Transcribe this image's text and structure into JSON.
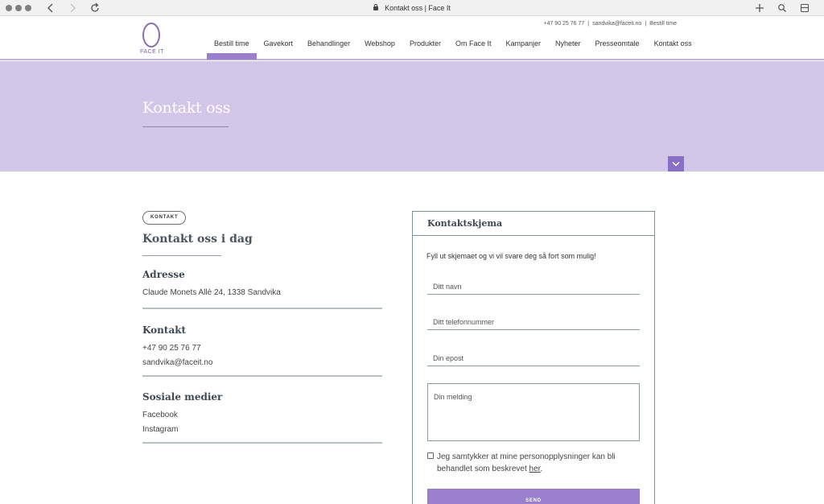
{
  "browser": {
    "tab_title": "Kontakt oss | Face It",
    "back_icon": "chevron-left-icon",
    "forward_icon": "chevron-right-icon",
    "reload_icon": "reload-icon",
    "new_tab_icon": "plus-icon",
    "search_icon": "magnifier-icon",
    "sidebar_icon": "tabs-icon"
  },
  "header": {
    "logo_text": "FACE IT",
    "top_phone": "+47 90 25 76 77",
    "top_email": "sandvika@faceit.no",
    "top_booking": "Bestill time",
    "top_separator": "|",
    "nav": [
      {
        "label": "Bestill time",
        "active": true
      },
      {
        "label": "Gavekort"
      },
      {
        "label": "Behandlinger"
      },
      {
        "label": "Webshop"
      },
      {
        "label": "Produkter"
      },
      {
        "label": "Om Face It"
      },
      {
        "label": "Kampanjer"
      },
      {
        "label": "Nyheter"
      },
      {
        "label": "Presseomtale"
      },
      {
        "label": "Kontakt oss"
      }
    ]
  },
  "hero": {
    "title": "Kontakt oss",
    "scroll_icon": "chevron-down-icon"
  },
  "contact": {
    "tag": "KONTAKT",
    "title": "Kontakt oss i dag",
    "address_heading": "Adresse",
    "address": "Claude Monets Allè 24, 1338 Sandvika",
    "contact_heading": "Kontakt",
    "phone": "+47 90 25 76 77",
    "email": "sandvika@faceit.no",
    "social_heading": "Sosiale medier",
    "facebook": "Facebook",
    "instagram": "Instagram"
  },
  "form": {
    "title": "Kontaktskjema",
    "intro": "Fyll ut skjemaet og vi vil svare deg så fort som mulig!",
    "name_placeholder": "Ditt navn",
    "phone_placeholder": "Ditt telefonnummer",
    "email_placeholder": "Din epost",
    "message_placeholder": "Din melding",
    "consent_text": "Jeg samtykker at mine personopplysninger kan bli behandlet som beskrevet ",
    "consent_link": "her",
    "consent_end": ".",
    "send_label": "SEND",
    "accent": "#9a80cc"
  }
}
